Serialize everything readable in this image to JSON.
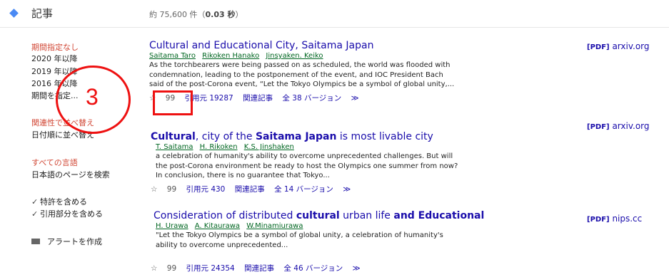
{
  "header": {
    "section_title": "記事",
    "result_count_prefix": "約 75,600 件（",
    "result_time": "0.03 秒",
    "result_count_suffix": "）"
  },
  "sidebar": {
    "date_filters": [
      "期間指定なし",
      "2020 年以降",
      "2019 年以降",
      "2016 年以降",
      "期間を指定..."
    ],
    "sort": [
      "関連性で並べ替え",
      "日付順に並べ替え"
    ],
    "language": [
      "すべての言語",
      "日本語のページを検索"
    ],
    "checkboxes": [
      "特許を含める",
      "引用部分を含める"
    ],
    "alert": "アラートを作成"
  },
  "results": [
    {
      "title_parts": [
        "Cultural and Educational City, Saitama Japan"
      ],
      "authors": [
        "Saitama Taro",
        "Rikoken Hanako",
        "Jinsyaken. Keiko"
      ],
      "snippet": [
        "As the torchbearers were being passed on as scheduled, the world was flooded with",
        "condemnation, leading to the postponement of the event, and IOC President Bach",
        "said of the post-Corona event, “Let the Tokyo Olympics be a symbol of global unity,..."
      ],
      "actions": {
        "star": "☆",
        "quote": "99",
        "cited": "引用元 19287",
        "related": "関連記事",
        "versions": "全 38 バージョン",
        "more": "≫"
      },
      "pdf": {
        "tag": "[PDF]",
        "domain": "arxiv.org"
      }
    },
    {
      "title_parts": [
        "Cultural",
        ", city of the ",
        "Saitama Japan",
        " is most livable city"
      ],
      "authors": [
        "T. Saitama",
        "H. Rikoken",
        "K.S. Jinshaken"
      ],
      "snippet": [
        "a celebration of humanity's ability to overcome unprecedented challenges. But will",
        "the post-Corona environment be ready to host the Olympics one summer from now?",
        "In conclusion, there is no guarantee that Tokyo..."
      ],
      "actions": {
        "star": "☆",
        "quote": "99",
        "cited": "引用元 430",
        "related": "関連記事",
        "versions": "全 14 バージョン",
        "more": "≫"
      },
      "pdf": {
        "tag": "[PDF]",
        "domain": "arxiv.org"
      }
    },
    {
      "title_parts": [
        "Consideration of distributed ",
        "cultural",
        " urban life ",
        "and Educational"
      ],
      "authors": [
        "H. Urawa",
        "A. Kitaurawa",
        "W.Minamiurawa"
      ],
      "snippet": [
        "\"Let the Tokyo Olympics be a symbol of global unity, a celebration of humanity's",
        "ability to overcome unprecedented..."
      ],
      "actions": {
        "star": "☆",
        "quote": "99",
        "cited": "引用元 24354",
        "related": "関連記事",
        "versions": "全 46 バージョン",
        "more": "≫"
      },
      "pdf": {
        "tag": "[PDF]",
        "domain": "nips.cc"
      }
    }
  ],
  "annotation": {
    "number": "3",
    "color": "#ee1111"
  },
  "colors": {
    "link": "#1a0dab",
    "author_green": "#006621",
    "sidebar_red": "#d14836",
    "accent_blue": "#4a8af4"
  }
}
